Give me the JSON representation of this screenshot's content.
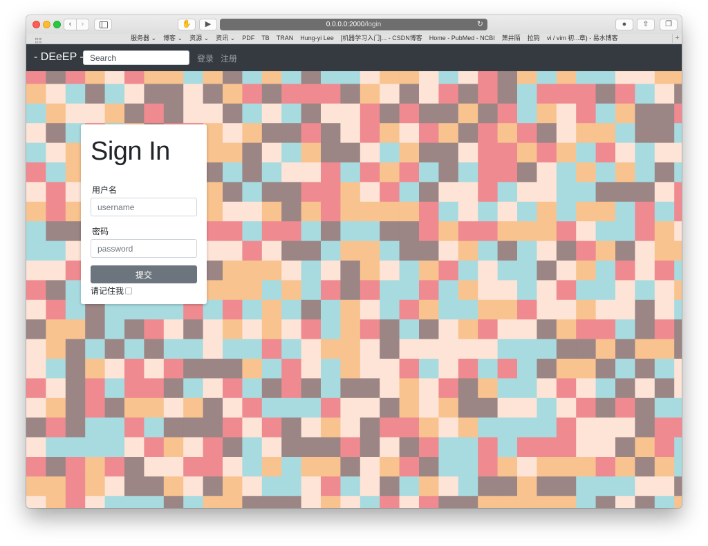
{
  "browser": {
    "url_host": "0.0.0.0:2000",
    "url_path": "/login",
    "bookmarks": [
      "服务器 ⌄",
      "博客 ⌄",
      "资源 ⌄",
      "资讯 ⌄",
      "PDF",
      "TB",
      "TRAN",
      "Hung-yi Lee",
      "[机器学习入门]... - CSDN博客",
      "Home - PubMed - NCBI",
      "萧井陌",
      "拉钩",
      "vi / vim 初...章) - 易水博客"
    ]
  },
  "navbar": {
    "brand": "- DEeEP -",
    "search_placeholder": "Search",
    "login": "登录",
    "register": "注册"
  },
  "login_form": {
    "title": "Sign In",
    "username_label": "用户名",
    "username_placeholder": "username",
    "password_label": "密码",
    "password_placeholder": "password",
    "submit": "提交",
    "remember": "请记住我"
  },
  "colors": {
    "navbar": "#343a40",
    "mosaic": [
      "#a8dbe0",
      "#9b8585",
      "#ef8a90",
      "#fde4d6",
      "#f8c38f"
    ]
  }
}
